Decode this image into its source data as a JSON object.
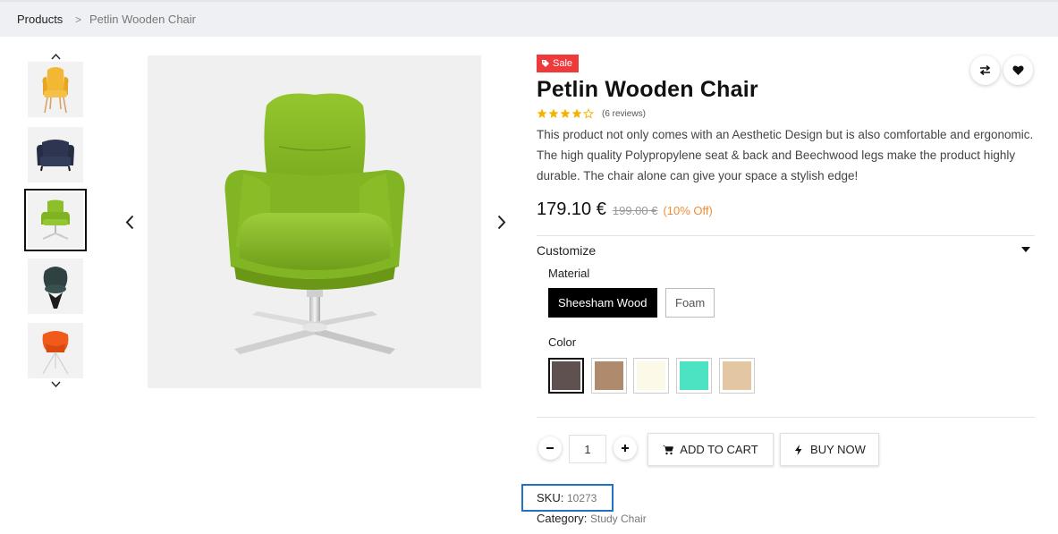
{
  "breadcrumb": {
    "home": "Products",
    "separator": ">",
    "current": "Petlin Wooden Chair"
  },
  "gallery": {
    "thumbnails": [
      {
        "name": "yellow-chair",
        "color": "#f2b733"
      },
      {
        "name": "navy-armchair",
        "color": "#2d3550"
      },
      {
        "name": "green-swivel-chair",
        "color": "#8cbf2a"
      },
      {
        "name": "dark-green-tub-chair",
        "color": "#2f4142"
      },
      {
        "name": "orange-chair",
        "color": "#f05a1a"
      }
    ],
    "selected_index": 2
  },
  "product": {
    "badge": "Sale",
    "title": "Petlin Wooden Chair",
    "rating": 4,
    "rating_max": 5,
    "reviews": "(6 reviews)",
    "description": "This product not only comes with an Aesthetic Design but is also comfortable and ergonomic. The high quality Polypropylene seat & back and Beechwood legs make the product highly durable. The chair alone can give your space a stylish edge!",
    "price": "179.10 €",
    "old_price": "199.00 €",
    "discount": "(10% Off)"
  },
  "customize": {
    "label": "Customize",
    "material_label": "Material",
    "materials": [
      "Sheesham Wood",
      "Foam"
    ],
    "selected_material": "Sheesham Wood",
    "color_label": "Color",
    "colors": [
      "#5e5150",
      "#b08a6c",
      "#fdf9e9",
      "#4be3c2",
      "#e3c7a2"
    ],
    "selected_color_index": 0
  },
  "cart": {
    "quantity": "1",
    "add_to_cart": "ADD TO CART",
    "buy_now": "BUY NOW"
  },
  "meta": {
    "sku_label": "SKU:",
    "sku": "10273",
    "category_label": "Category:",
    "category": "Study Chair"
  },
  "colors": {
    "sale": "#ee3a3a",
    "discount": "#f08c3a",
    "highlight": "#1f73c7",
    "star": "#f5b400"
  }
}
